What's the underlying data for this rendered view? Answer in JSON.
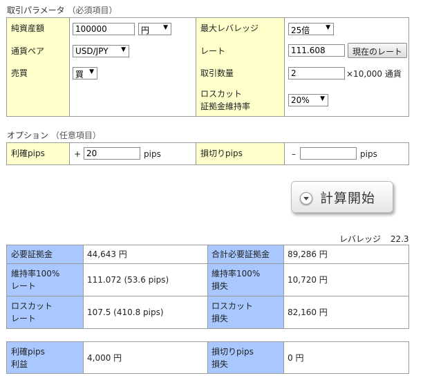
{
  "params": {
    "section_title": "取引パラメータ",
    "section_sub": "（必須項目）",
    "net_assets_label": "純資産額",
    "net_assets_value": "100000",
    "currency_unit": "円",
    "max_leverage_label": "最大レバレッジ",
    "max_leverage_value": "25倍",
    "pair_label": "通貨ペア",
    "pair_value": "USD/JPY",
    "rate_label": "レート",
    "rate_value": "111.608",
    "current_rate_button": "現在のレート",
    "side_label": "売買",
    "side_value": "買",
    "lots_label": "取引数量",
    "lots_value": "2",
    "lots_unit": "×10,000 通貨",
    "losscut_label_1": "ロスカット",
    "losscut_label_2": "証拠金維持率",
    "losscut_value": "20%"
  },
  "options": {
    "section_title": "オプション",
    "section_sub": "（任意項目）",
    "tp_label": "利確pips",
    "tp_sign": "+",
    "tp_value": "20",
    "tp_unit": "pips",
    "sl_label": "損切りpips",
    "sl_sign": "–",
    "sl_value": "",
    "sl_unit": "pips"
  },
  "calc_button": "計算開始",
  "results": {
    "leverage_label": "レバレッジ",
    "leverage_value": "22.3",
    "margin_label": "必要証拠金",
    "margin_value": "44,643 円",
    "total_margin_label": "合計必要証拠金",
    "total_margin_value": "89,286 円",
    "maint100_rate_label_1": "維持率100%",
    "maint100_rate_label_2": "レート",
    "maint100_rate_value": "111.072 (53.6 pips)",
    "maint100_loss_label_1": "維持率100%",
    "maint100_loss_label_2": "損失",
    "maint100_loss_value": "10,720 円",
    "lc_rate_label_1": "ロスカット",
    "lc_rate_label_2": "レート",
    "lc_rate_value": "107.5 (410.8 pips)",
    "lc_loss_label_1": "ロスカット",
    "lc_loss_label_2": "損失",
    "lc_loss_value": "82,160 円"
  },
  "pl": {
    "tp_profit_label_1": "利確pips",
    "tp_profit_label_2": "利益",
    "tp_profit_value": "4,000 円",
    "sl_loss_label_1": "損切りpips",
    "sl_loss_label_2": "損失",
    "sl_loss_value": "0 円"
  }
}
